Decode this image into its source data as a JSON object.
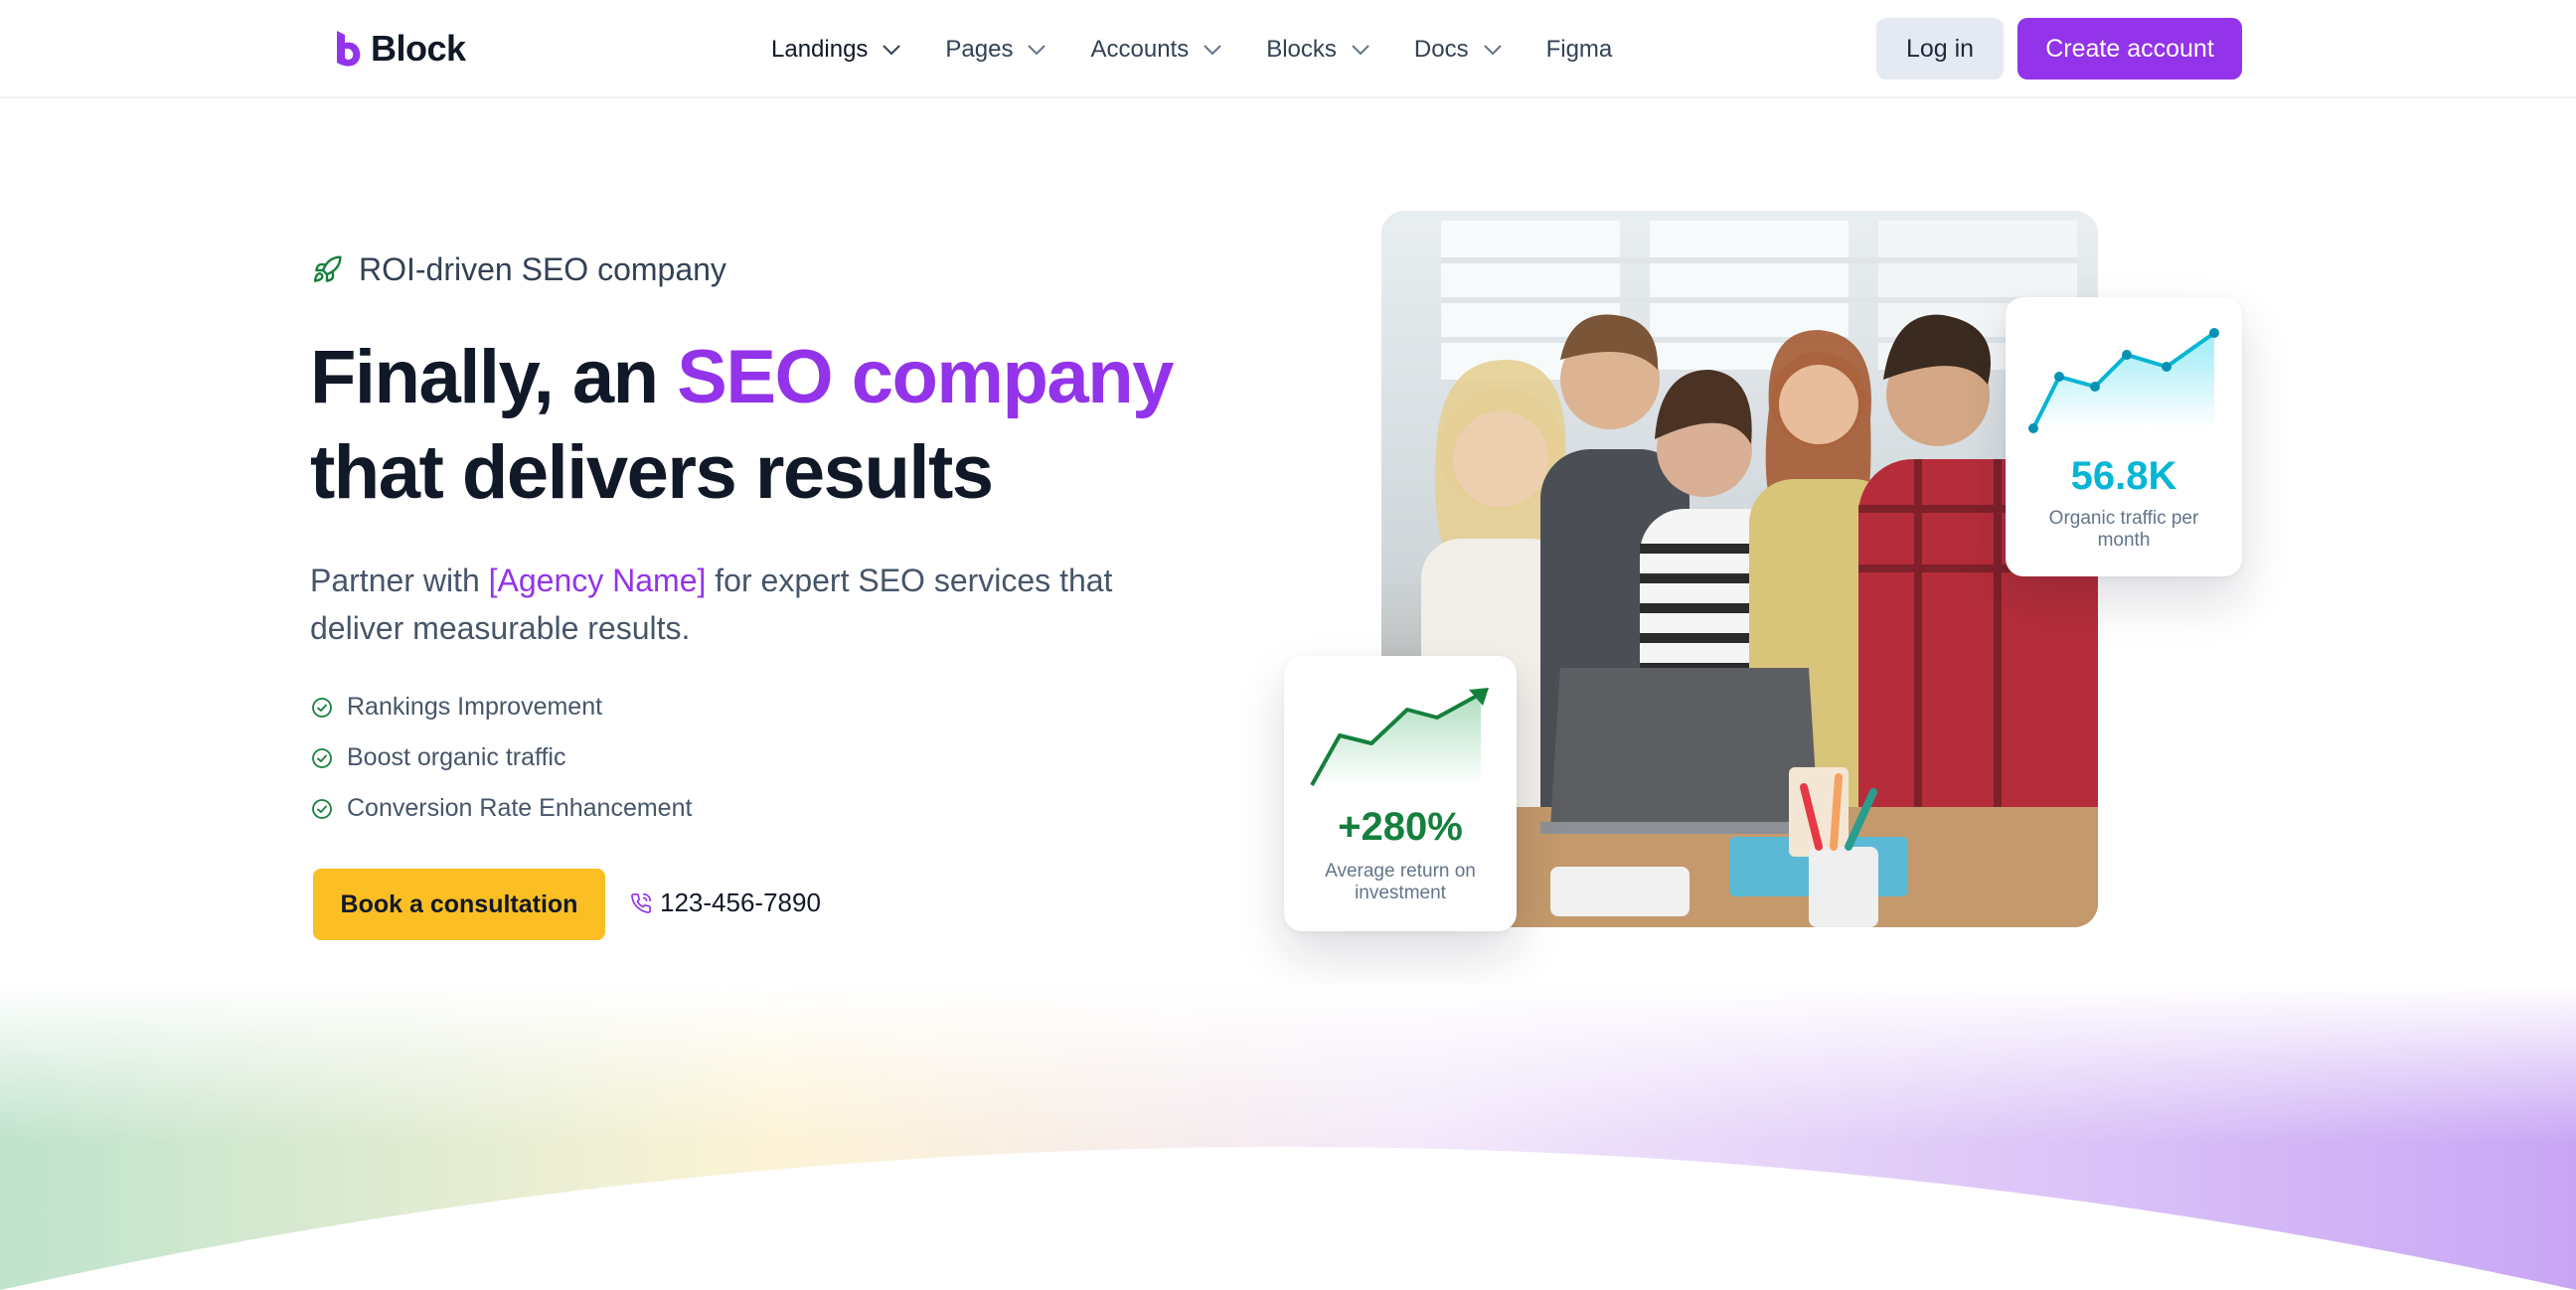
{
  "nav": {
    "brand": "Block",
    "items": [
      {
        "label": "Landings",
        "dropdown": true,
        "active": true
      },
      {
        "label": "Pages",
        "dropdown": true
      },
      {
        "label": "Accounts",
        "dropdown": true
      },
      {
        "label": "Blocks",
        "dropdown": true
      },
      {
        "label": "Docs",
        "dropdown": true
      },
      {
        "label": "Figma",
        "dropdown": false
      }
    ],
    "login_label": "Log in",
    "create_label": "Create account"
  },
  "hero": {
    "eyebrow": "ROI-driven SEO company",
    "headline_part1": "Finally, an ",
    "headline_highlight": "SEO company",
    "headline_part2": "that delivers results",
    "sub_part1": "Partner with ",
    "sub_accent": "[Agency Name]",
    "sub_part2": " for expert SEO services that deliver measurable results.",
    "features": [
      "Rankings Improvement",
      "Boost organic traffic",
      "Conversion Rate Enhancement"
    ],
    "cta_label": "Book a consultation",
    "phone": "123-456-7890"
  },
  "stats": {
    "traffic_value": "56.8K",
    "traffic_label": "Organic traffic per month",
    "roi_value": "+280%",
    "roi_label": "Average return on investment"
  },
  "colors": {
    "brand": "#9333ea",
    "cta": "#fbbf24",
    "success": "#15803d",
    "traffic": "#06b6d4",
    "heading": "#111827",
    "body": "#475569"
  },
  "icons": {
    "eyebrow": "rocket-icon",
    "feature": "check-circle-icon",
    "phone": "phone-icon",
    "dropdown": "chevron-down-icon"
  }
}
